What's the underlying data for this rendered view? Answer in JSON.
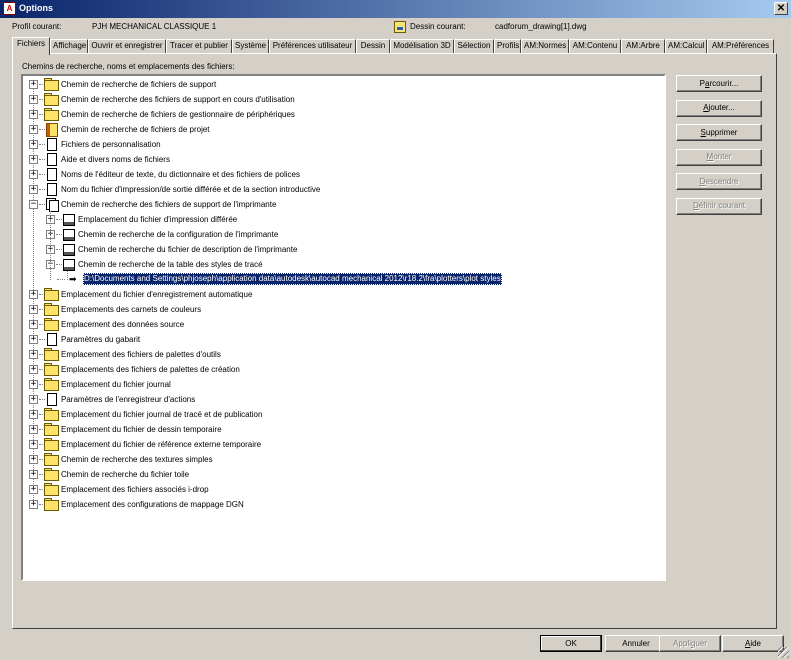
{
  "window": {
    "title": "Options",
    "close_glyph": "✕",
    "app_icon_letter": "A"
  },
  "profile": {
    "label": "Profil courant:",
    "value": "PJH MECHANICAL CLASSIQUE 1"
  },
  "drawing": {
    "label": "Dessin courant:",
    "value": "cadforum_drawing[1].dwg"
  },
  "tabs": [
    {
      "label": "Fichiers",
      "active": true
    },
    {
      "label": "Affichage"
    },
    {
      "label": "Ouvrir et enregistrer"
    },
    {
      "label": "Tracer et publier"
    },
    {
      "label": "Système"
    },
    {
      "label": "Préférences utilisateur"
    },
    {
      "label": "Dessin"
    },
    {
      "label": "Modélisation 3D"
    },
    {
      "label": "Sélection"
    },
    {
      "label": "Profils"
    },
    {
      "label": "AM:Normes"
    },
    {
      "label": "AM:Contenu"
    },
    {
      "label": "AM:Arbre"
    },
    {
      "label": "AM:Calcul"
    },
    {
      "label": "AM:Préférences"
    }
  ],
  "panel_label": "Chemins de recherche, noms et emplacements des fichiers:",
  "tree": [
    {
      "label": "Chemin de recherche de fichiers de support",
      "icon": "folder-icon"
    },
    {
      "label": "Chemin de recherche des fichiers de support en cours d'utilisation",
      "icon": "folder-icon"
    },
    {
      "label": "Chemin de recherche de fichiers de gestionnaire de périphériques",
      "icon": "folder-icon"
    },
    {
      "label": "Chemin de recherche de fichiers de projet",
      "icon": "project-icon"
    },
    {
      "label": "Fichiers de personnalisation",
      "icon": "file-icon"
    },
    {
      "label": "Aide et divers noms de fichiers",
      "icon": "file-icon"
    },
    {
      "label": "Noms de l'éditeur de texte, du dictionnaire et des fichiers de polices",
      "icon": "file-icon"
    },
    {
      "label": "Nom du fichier d'impression/de sortie différée et de la section introductive",
      "icon": "file-icon"
    },
    {
      "label": "Chemin de recherche des fichiers de support de l'imprimante",
      "icon": "multi-file-icon",
      "expanded": true,
      "children": [
        {
          "label": "Emplacement du fichier d'impression différée",
          "icon": "printer-file-icon"
        },
        {
          "label": "Chemin de recherche de la configuration de l'imprimante",
          "icon": "printer-file-icon"
        },
        {
          "label": "Chemin de recherche du fichier de description de l'imprimante",
          "icon": "printer-file-icon"
        },
        {
          "label": "Chemin de recherche de la table des styles de tracé",
          "icon": "printer-file-icon",
          "expanded": true,
          "children": [
            {
              "label": "D:\\Documents and Settings\\phjoseph\\application data\\autodesk\\autocad mechanical 2012\\r18.2\\fra\\plotters\\plot styles",
              "icon": "arrow-icon",
              "selected": true
            }
          ]
        }
      ]
    },
    {
      "label": "Emplacement du fichier d'enregistrement automatique",
      "icon": "folder-icon"
    },
    {
      "label": "Emplacements des carnets de couleurs",
      "icon": "folder-icon"
    },
    {
      "label": "Emplacement des données source",
      "icon": "folder-icon"
    },
    {
      "label": "Paramètres du gabarit",
      "icon": "file-icon"
    },
    {
      "label": "Emplacement des fichiers de palettes d'outils",
      "icon": "folder-icon"
    },
    {
      "label": "Emplacements des fichiers de palettes de création",
      "icon": "folder-icon"
    },
    {
      "label": "Emplacement du fichier journal",
      "icon": "folder-icon"
    },
    {
      "label": "Paramètres de l'enregistreur d'actions",
      "icon": "file-icon"
    },
    {
      "label": "Emplacement du fichier journal de tracé et de publication",
      "icon": "folder-icon"
    },
    {
      "label": "Emplacement du fichier de dessin temporaire",
      "icon": "folder-icon"
    },
    {
      "label": "Emplacement du fichier de référence externe temporaire",
      "icon": "folder-icon"
    },
    {
      "label": "Chemin de recherche des textures simples",
      "icon": "folder-icon"
    },
    {
      "label": "Chemin de recherche du fichier toile",
      "icon": "folder-icon"
    },
    {
      "label": "Emplacement des fichiers associés i-drop",
      "icon": "folder-icon"
    },
    {
      "label": "Emplacement des configurations de mappage DGN",
      "icon": "folder-icon"
    }
  ],
  "side_buttons": [
    {
      "name": "browse-button",
      "pre": "P",
      "ul": "a",
      "post": "rcourir...",
      "disabled": false
    },
    {
      "name": "add-button",
      "pre": "",
      "ul": "A",
      "post": "jouter...",
      "disabled": false
    },
    {
      "name": "remove-button",
      "pre": "",
      "ul": "S",
      "post": "upprimer",
      "disabled": false
    },
    {
      "name": "move-up-button",
      "pre": "",
      "ul": "M",
      "post": "onter",
      "disabled": true
    },
    {
      "name": "move-down-button",
      "pre": "",
      "ul": "D",
      "post": "escendre",
      "disabled": true
    },
    {
      "name": "set-current-button",
      "pre": "",
      "ul": "D",
      "post": "éfinir courant",
      "disabled": true
    }
  ],
  "footer_buttons": [
    {
      "name": "ok-button",
      "pre": "OK",
      "ul": "",
      "post": "",
      "disabled": false,
      "default": true
    },
    {
      "name": "cancel-button",
      "pre": "Annuler",
      "ul": "",
      "post": "",
      "disabled": false
    },
    {
      "name": "apply-button",
      "pre": "Appli",
      "ul": "q",
      "post": "uer",
      "disabled": true
    },
    {
      "name": "help-button",
      "pre": "",
      "ul": "A",
      "post": "ide",
      "disabled": false
    }
  ]
}
